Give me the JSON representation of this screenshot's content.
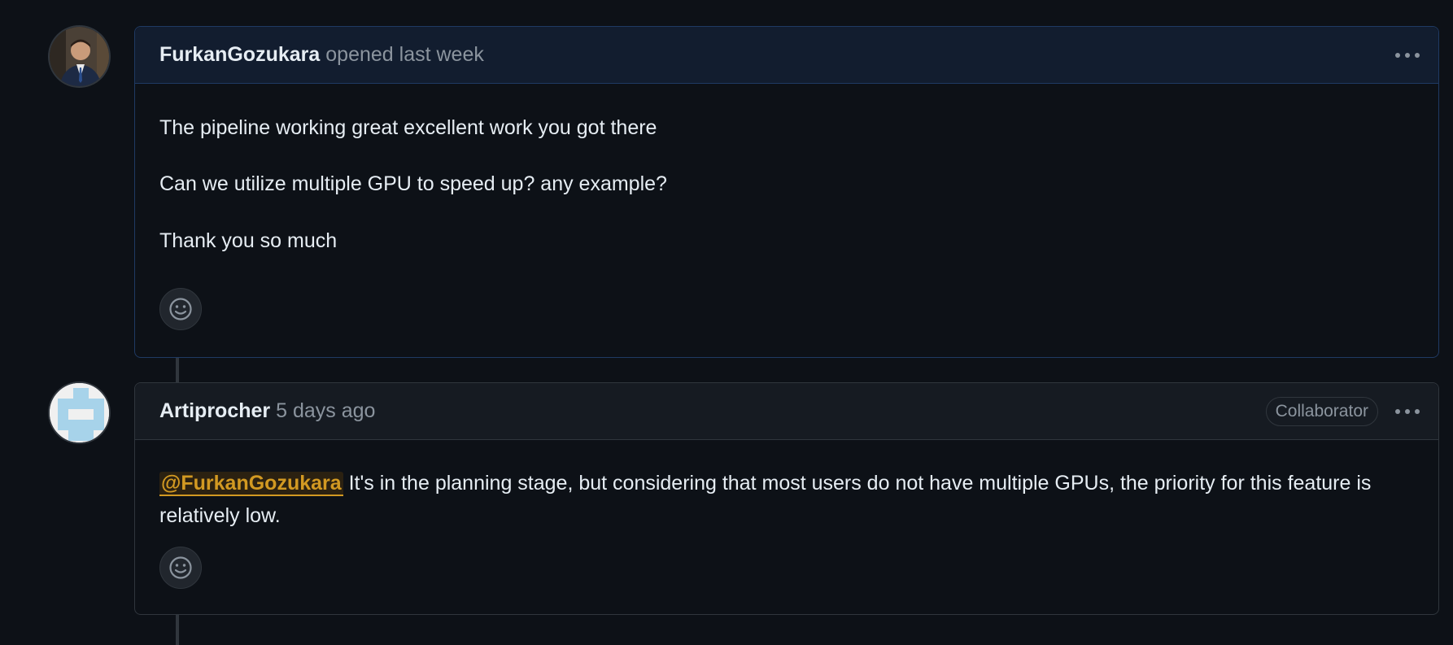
{
  "comments": [
    {
      "author": "FurkanGozukara",
      "meta": "opened last week",
      "paragraphs": [
        "The pipeline working great excellent work you got there",
        "Can we utilize multiple GPU to speed up? any example?",
        "Thank you so much"
      ],
      "avatar_icon": "user-photo-avatar",
      "reaction_icon": "smiley-icon",
      "menu_icon": "kebab-icon"
    },
    {
      "author": "Artiprocher",
      "meta": "5 days ago",
      "badge": "Collaborator",
      "mention": "@FurkanGozukara",
      "body_text": " It's in the planning stage, but considering that most users do not have multiple GPUs, the priority for this feature is relatively low.",
      "avatar_icon": "identicon-avatar",
      "reaction_icon": "smiley-icon",
      "menu_icon": "kebab-icon"
    }
  ],
  "colors": {
    "background": "#0d1117",
    "header_bg": "#161b22",
    "owner_header_bg": "#121d2f",
    "border": "#30363d",
    "owner_border": "#1f3a63",
    "mention": "#d29922",
    "identicon": "#a7d3ea"
  }
}
